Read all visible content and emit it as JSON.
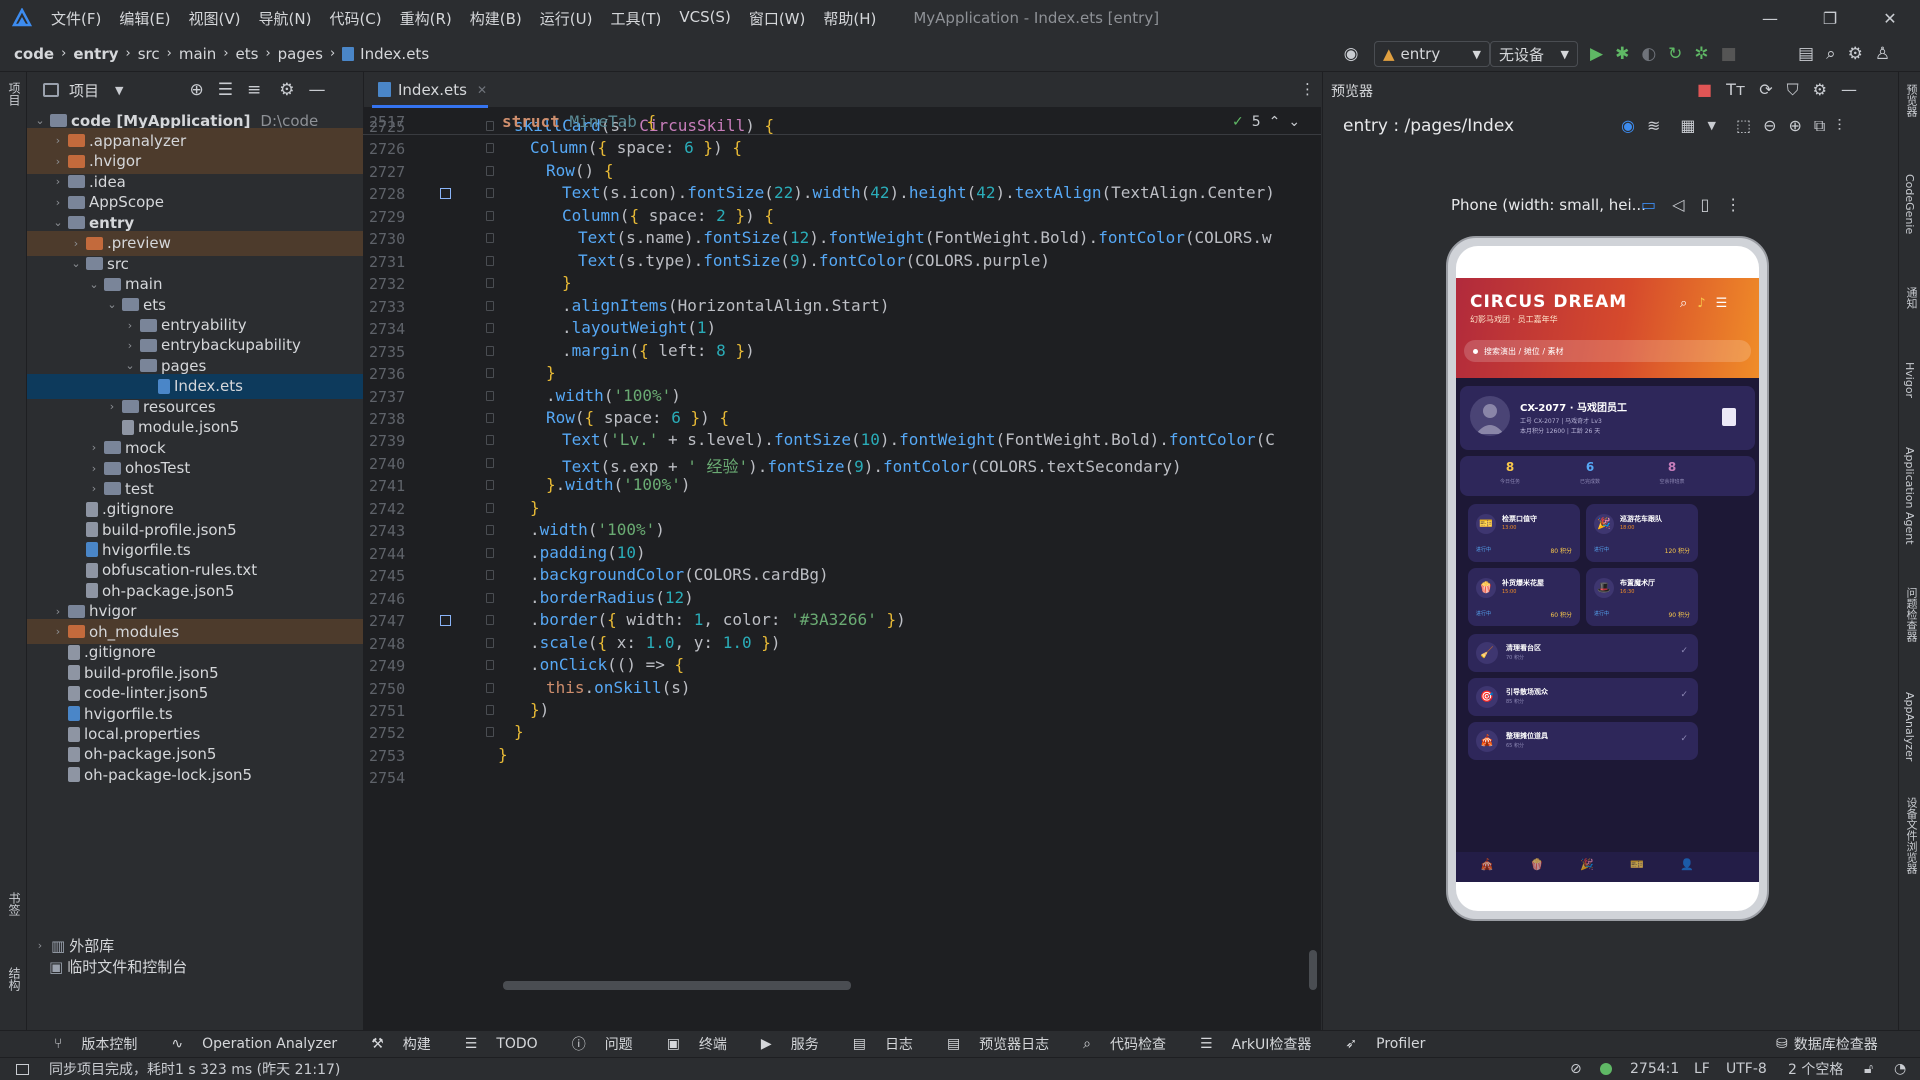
{
  "titlebar": {
    "menus": [
      "文件(F)",
      "编辑(E)",
      "视图(V)",
      "导航(N)",
      "代码(C)",
      "重构(R)",
      "构建(B)",
      "运行(U)",
      "工具(T)",
      "VCS(S)",
      "窗口(W)",
      "帮助(H)"
    ],
    "window_title": "MyApplication - Index.ets [entry]"
  },
  "navbar": {
    "crumbs": [
      "code",
      "entry",
      "src",
      "main",
      "ets",
      "pages",
      "Index.ets"
    ],
    "run_config": "entry",
    "device": "无设备"
  },
  "project": {
    "header": "项目",
    "root_label": "code [MyApplication]",
    "root_path": "D:\\code",
    "items": [
      {
        "label": ".appanalyzer",
        "depth": 1,
        "type": "folder-orange",
        "arrow": "›",
        "hl": true
      },
      {
        "label": ".hvigor",
        "depth": 1,
        "type": "folder-orange",
        "arrow": "›",
        "hl": true
      },
      {
        "label": ".idea",
        "depth": 1,
        "type": "folder",
        "arrow": "›"
      },
      {
        "label": "AppScope",
        "depth": 1,
        "type": "folder",
        "arrow": "›"
      },
      {
        "label": "entry",
        "depth": 1,
        "type": "folder",
        "arrow": "⌄",
        "bold": true
      },
      {
        "label": ".preview",
        "depth": 2,
        "type": "folder-orange",
        "arrow": "›",
        "hl": true
      },
      {
        "label": "src",
        "depth": 2,
        "type": "folder",
        "arrow": "⌄"
      },
      {
        "label": "main",
        "depth": 3,
        "type": "folder",
        "arrow": "⌄"
      },
      {
        "label": "ets",
        "depth": 4,
        "type": "folder",
        "arrow": "⌄"
      },
      {
        "label": "entryability",
        "depth": 5,
        "type": "folder",
        "arrow": "›"
      },
      {
        "label": "entrybackupability",
        "depth": 5,
        "type": "folder",
        "arrow": "›"
      },
      {
        "label": "pages",
        "depth": 5,
        "type": "folder",
        "arrow": "⌄"
      },
      {
        "label": "Index.ets",
        "depth": 6,
        "type": "file-ts",
        "arrow": "",
        "selected": true
      },
      {
        "label": "resources",
        "depth": 4,
        "type": "folder",
        "arrow": "›"
      },
      {
        "label": "module.json5",
        "depth": 4,
        "type": "file",
        "arrow": ""
      },
      {
        "label": "mock",
        "depth": 3,
        "type": "folder",
        "arrow": "›"
      },
      {
        "label": "ohosTest",
        "depth": 3,
        "type": "folder",
        "arrow": "›"
      },
      {
        "label": "test",
        "depth": 3,
        "type": "folder",
        "arrow": "›"
      },
      {
        "label": ".gitignore",
        "depth": 2,
        "type": "file",
        "arrow": ""
      },
      {
        "label": "build-profile.json5",
        "depth": 2,
        "type": "file",
        "arrow": ""
      },
      {
        "label": "hvigorfile.ts",
        "depth": 2,
        "type": "file-ts",
        "arrow": ""
      },
      {
        "label": "obfuscation-rules.txt",
        "depth": 2,
        "type": "file",
        "arrow": ""
      },
      {
        "label": "oh-package.json5",
        "depth": 2,
        "type": "file",
        "arrow": ""
      },
      {
        "label": "hvigor",
        "depth": 1,
        "type": "folder",
        "arrow": "›"
      },
      {
        "label": "oh_modules",
        "depth": 1,
        "type": "folder-orange",
        "arrow": "›",
        "hl": true
      },
      {
        "label": ".gitignore",
        "depth": 1,
        "type": "file",
        "arrow": ""
      },
      {
        "label": "build-profile.json5",
        "depth": 1,
        "type": "file",
        "arrow": ""
      },
      {
        "label": "code-linter.json5",
        "depth": 1,
        "type": "file",
        "arrow": ""
      },
      {
        "label": "hvigorfile.ts",
        "depth": 1,
        "type": "file-ts",
        "arrow": ""
      },
      {
        "label": "local.properties",
        "depth": 1,
        "type": "file",
        "arrow": ""
      },
      {
        "label": "oh-package.json5",
        "depth": 1,
        "type": "file",
        "arrow": ""
      },
      {
        "label": "oh-package-lock.json5",
        "depth": 1,
        "type": "file",
        "arrow": ""
      }
    ],
    "external_libs": "外部库",
    "scratches": "临时文件和控制台"
  },
  "editor": {
    "tab_label": "Index.ets",
    "sticky_line_no": "2517",
    "sticky_code": "struct MineTab {",
    "inspection_count": "5",
    "lines": [
      {
        "no": "2725",
        "html": "<span style='padding-left:16px'></span><span class='fn'>skillCard</span>(s: <span class='ty'>CircusSkill</span>) <span class='br'>{</span>"
      },
      {
        "no": "2726",
        "html": "<span style='padding-left:32px'></span><span class='fn'>Column</span>(<span class='br'>{</span> space: <span class='nm'>6</span> <span class='br'>}</span>) <span class='br'>{</span>"
      },
      {
        "no": "2727",
        "html": "<span style='padding-left:48px'></span><span class='fn'>Row</span>() <span class='br'>{</span>"
      },
      {
        "no": "2728",
        "html": "<span style='padding-left:64px'></span><span class='fn'>Text</span>(s.icon).<span class='fn'>fontSize</span>(<span class='nm'>22</span>).<span class='fn'>width</span>(<span class='nm'>42</span>).<span class='fn'>height</span>(<span class='nm'>42</span>).<span class='fn'>textAlign</span>(TextAlign.Center)"
      },
      {
        "no": "2729",
        "html": "<span style='padding-left:64px'></span><span class='fn'>Column</span>(<span class='br'>{</span> space: <span class='nm'>2</span> <span class='br'>}</span>) <span class='br'>{</span>"
      },
      {
        "no": "2730",
        "html": "<span style='padding-left:80px'></span><span class='fn'>Text</span>(s.name).<span class='fn'>fontSize</span>(<span class='nm'>12</span>).<span class='fn'>fontWeight</span>(FontWeight.Bold).<span class='fn'>fontColor</span>(COLORS.w"
      },
      {
        "no": "2731",
        "html": "<span style='padding-left:80px'></span><span class='fn'>Text</span>(s.type).<span class='fn'>fontSize</span>(<span class='nm'>9</span>).<span class='fn'>fontColor</span>(COLORS.purple)"
      },
      {
        "no": "2732",
        "html": "<span style='padding-left:64px'></span><span class='br'>}</span>"
      },
      {
        "no": "2733",
        "html": "<span style='padding-left:64px'></span>.<span class='fn'>alignItems</span>(HorizontalAlign.Start)"
      },
      {
        "no": "2734",
        "html": "<span style='padding-left:64px'></span>.<span class='fn'>layoutWeight</span>(<span class='nm'>1</span>)"
      },
      {
        "no": "2735",
        "html": "<span style='padding-left:64px'></span>.<span class='fn'>margin</span>(<span class='br'>{</span> left: <span class='nm'>8</span> <span class='br'>}</span>)"
      },
      {
        "no": "2736",
        "html": "<span style='padding-left:48px'></span><span class='br'>}</span>"
      },
      {
        "no": "2737",
        "html": "<span style='padding-left:48px'></span>.<span class='fn'>width</span>(<span class='st'>'100%'</span>)"
      },
      {
        "no": "2738",
        "html": "<span style='padding-left:48px'></span><span class='fn'>Row</span>(<span class='br'>{</span> space: <span class='nm'>6</span> <span class='br'>}</span>) <span class='br'>{</span>"
      },
      {
        "no": "2739",
        "html": "<span style='padding-left:64px'></span><span class='fn'>Text</span>(<span class='st'>'Lv.'</span> + s.level).<span class='fn'>fontSize</span>(<span class='nm'>10</span>).<span class='fn'>fontWeight</span>(FontWeight.Bold).<span class='fn'>fontColor</span>(C"
      },
      {
        "no": "2740",
        "html": "<span style='padding-left:64px'></span><span class='fn'>Text</span>(s.exp + <span class='st'>' 经验'</span>).<span class='fn'>fontSize</span>(<span class='nm'>9</span>).<span class='fn'>fontColor</span>(COLORS.textSecondary)"
      },
      {
        "no": "2741",
        "html": "<span style='padding-left:48px'></span><span class='br'>}</span>.<span class='fn'>width</span>(<span class='st'>'100%'</span>)"
      },
      {
        "no": "2742",
        "html": "<span style='padding-left:32px'></span><span class='br'>}</span>"
      },
      {
        "no": "2743",
        "html": "<span style='padding-left:32px'></span>.<span class='fn'>width</span>(<span class='st'>'100%'</span>)"
      },
      {
        "no": "2744",
        "html": "<span style='padding-left:32px'></span>.<span class='fn'>padding</span>(<span class='nm'>10</span>)"
      },
      {
        "no": "2745",
        "html": "<span style='padding-left:32px'></span>.<span class='fn'>backgroundColor</span>(COLORS.cardBg)"
      },
      {
        "no": "2746",
        "html": "<span style='padding-left:32px'></span>.<span class='fn'>borderRadius</span>(<span class='nm'>12</span>)"
      },
      {
        "no": "2747",
        "html": "<span style='padding-left:32px'></span>.<span class='fn'>border</span>(<span class='br'>{</span> width: <span class='nm'>1</span>, color: <span class='st'>'#3A3266'</span> <span class='br'>}</span>)"
      },
      {
        "no": "2748",
        "html": "<span style='padding-left:32px'></span>.<span class='fn'>scale</span>(<span class='br'>{</span> x: <span class='nm'>1.0</span>, y: <span class='nm'>1.0</span> <span class='br'>}</span>)"
      },
      {
        "no": "2749",
        "html": "<span style='padding-left:32px'></span>.<span class='fn'>onClick</span>(() => <span class='br'>{</span>"
      },
      {
        "no": "2750",
        "html": "<span style='padding-left:48px'></span><span class='kw'>this</span>.<span class='fn'>onSkill</span>(s)"
      },
      {
        "no": "2751",
        "html": "<span style='padding-left:32px'></span><span class='br'>}</span>)"
      },
      {
        "no": "2752",
        "html": "<span style='padding-left:16px'></span><span class='br'>}</span>"
      },
      {
        "no": "2753",
        "html": "<span class='br'>}</span>"
      },
      {
        "no": "2754",
        "html": ""
      }
    ]
  },
  "preview": {
    "panel_title": "预览器",
    "route": "entry : /pages/Index",
    "device_label": "Phone (width: small, hei...",
    "app": {
      "brand": "CIRCUS DREAM",
      "brand_sub": "幻影马戏团 · 员工嘉年华",
      "search_placeholder": "搜索演出 / 摊位 / 素材",
      "profile_name": "CX-2077 · 马戏团员工",
      "profile_line1": "工号 CX-2077 | 马戏奇才 Lv3",
      "profile_line2": "本月积分 12600 | 工龄 26 天",
      "stats": [
        {
          "value": "8",
          "label": "今日任务"
        },
        {
          "value": "6",
          "label": "已完成数"
        },
        {
          "value": "8",
          "label": "空余排班表"
        }
      ],
      "cards": [
        {
          "icon": "🎫",
          "title": "检票口值守",
          "time": "13:00",
          "status": "进行中",
          "points": "80 积分"
        },
        {
          "icon": "🎉",
          "title": "巡游花车跟队",
          "time": "18:00",
          "status": "进行中",
          "points": "120 积分"
        },
        {
          "icon": "🍿",
          "title": "补货爆米花屋",
          "time": "15:00",
          "status": "进行中",
          "points": "60 积分"
        },
        {
          "icon": "🎩",
          "title": "布置魔术厅",
          "time": "16:30",
          "status": "进行中",
          "points": "90 积分"
        }
      ],
      "tasks": [
        {
          "icon": "🧹",
          "title": "清理看台区",
          "sub": "70 积分"
        },
        {
          "icon": "🎯",
          "title": "引导散场观众",
          "sub": "85 积分"
        },
        {
          "icon": "🎪",
          "title": "整理摊位道具",
          "sub": "65 积分"
        }
      ],
      "nav_icons": [
        "🎪",
        "🍿",
        "🎉",
        "🎫",
        "👤"
      ]
    }
  },
  "bottom_tools": [
    "版本控制",
    "Operation Analyzer",
    "构建",
    "TODO",
    "问题",
    "终端",
    "服务",
    "日志",
    "预览器日志",
    "代码检查",
    "ArkUI检查器",
    "Profiler"
  ],
  "db_inspector": "数据库检查器",
  "status": {
    "message": "同步项目完成，耗时1 s 323 ms (昨天 21:17)",
    "position": "2754:1",
    "line_sep": "LF",
    "encoding": "UTF-8",
    "indent": "2 个空格"
  },
  "right_strip": [
    "预览器",
    "CodeGenie",
    "通知",
    "Hvigor",
    "Application Agent",
    "问题检查器",
    "AppAnalyzer",
    "设备文件浏览器"
  ],
  "left_strip": [
    "项目",
    "书签",
    "结构"
  ]
}
